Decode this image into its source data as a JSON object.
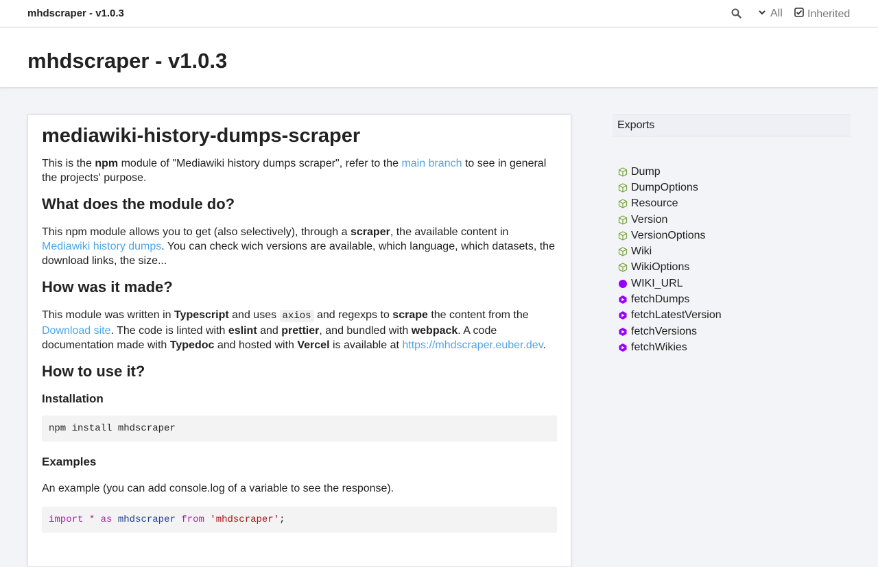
{
  "toolbar": {
    "brand": "mhdscraper - v1.0.3",
    "all_label": "All",
    "inherited_label": "Inherited"
  },
  "header": {
    "title": "mhdscraper - v1.0.3"
  },
  "readme": {
    "title": "mediawiki-history-dumps-scraper",
    "intro": {
      "a": "This is the ",
      "b": "npm",
      "c": " module of \"Mediawiki history dumps scraper\", refer to the ",
      "link": "main branch",
      "d": " to see in general the projects' purpose."
    },
    "h_what": "What does the module do?",
    "what": {
      "a": "This npm module allows you to get (also selectively), through a ",
      "b": "scraper",
      "c": ", the available content in ",
      "link": "Mediawiki history dumps",
      "d": ". You can check wich versions are available, which language, which datasets, the download links, the size..."
    },
    "h_how": "How was it made?",
    "how": {
      "a": "This module was written in ",
      "typescript": "Typescript",
      "b": " and uses ",
      "axios": "axios",
      "c": " and regexps to ",
      "scrape": "scrape",
      "d": " the content from the",
      "link_download": "Download site",
      "e": ". The code is linted with ",
      "eslint": "eslint",
      "f": " and ",
      "prettier": "prettier",
      "g": ", and bundled with ",
      "webpack": "webpack",
      "h": ". A code documentation made with ",
      "typedoc": "Typedoc",
      "i": " and hosted with ",
      "vercel": "Vercel",
      "j": " is available at ",
      "link_site": "https://mhdscraper.euber.dev",
      "k": "."
    },
    "h_use": "How to use it?",
    "h_install": "Installation",
    "install_cmd": "npm install mhdscraper",
    "h_examples": "Examples",
    "examples_text": "An example (you can add console.log of a variable to see the response).",
    "code": {
      "import": "import",
      "star": "*",
      "as": "as",
      "name": "mhdscraper",
      "from": "from",
      "module": "'mhdscraper'",
      "semi": ";"
    }
  },
  "sidebar": {
    "heading": "Exports",
    "items": [
      {
        "label": "Dump",
        "kind": "class",
        "icon": "class-icon"
      },
      {
        "label": "DumpOptions",
        "kind": "class",
        "icon": "class-icon"
      },
      {
        "label": "Resource",
        "kind": "class",
        "icon": "class-icon"
      },
      {
        "label": "Version",
        "kind": "class",
        "icon": "class-icon"
      },
      {
        "label": "VersionOptions",
        "kind": "class",
        "icon": "class-icon"
      },
      {
        "label": "Wiki",
        "kind": "class",
        "icon": "class-icon"
      },
      {
        "label": "WikiOptions",
        "kind": "class",
        "icon": "class-icon"
      },
      {
        "label": "WIKI_URL",
        "kind": "variable",
        "icon": "variable-icon"
      },
      {
        "label": "fetchDumps",
        "kind": "function",
        "icon": "function-icon"
      },
      {
        "label": "fetchLatestVersion",
        "kind": "function",
        "icon": "function-icon"
      },
      {
        "label": "fetchVersions",
        "kind": "function",
        "icon": "function-icon"
      },
      {
        "label": "fetchWikies",
        "kind": "function",
        "icon": "function-icon"
      }
    ]
  },
  "colors": {
    "link": "#4da6e6",
    "class_icon": "#7aa83b",
    "variable_icon": "#9600ff",
    "function_icon": "#9600ff"
  }
}
